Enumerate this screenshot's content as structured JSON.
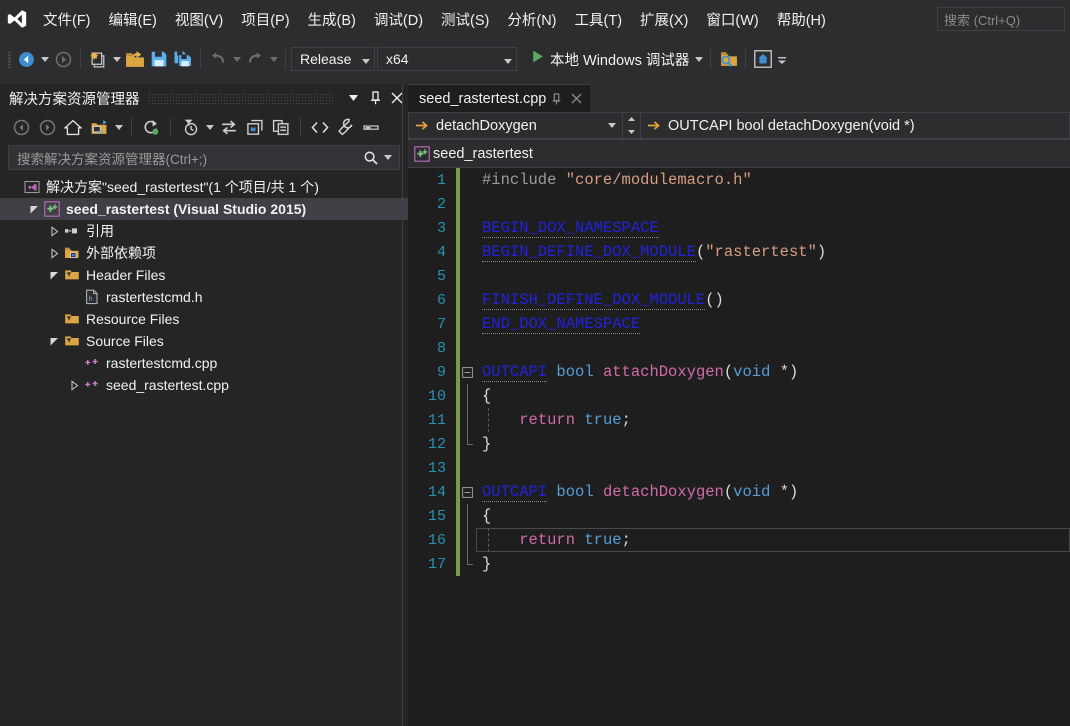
{
  "app": {
    "logo_icon": "visual-studio-logo",
    "theme_bg": "#2d2d30",
    "editor_bg": "#1e1e1e",
    "accent": "#007acc"
  },
  "menubar": {
    "items": [
      {
        "label": "文件(F)",
        "name": "menu-file"
      },
      {
        "label": "编辑(E)",
        "name": "menu-edit"
      },
      {
        "label": "视图(V)",
        "name": "menu-view"
      },
      {
        "label": "项目(P)",
        "name": "menu-project"
      },
      {
        "label": "生成(B)",
        "name": "menu-build"
      },
      {
        "label": "调试(D)",
        "name": "menu-debug"
      },
      {
        "label": "测试(S)",
        "name": "menu-test"
      },
      {
        "label": "分析(N)",
        "name": "menu-analyze"
      },
      {
        "label": "工具(T)",
        "name": "menu-tools"
      },
      {
        "label": "扩展(X)",
        "name": "menu-extensions"
      },
      {
        "label": "窗口(W)",
        "name": "menu-window"
      },
      {
        "label": "帮助(H)",
        "name": "menu-help"
      }
    ],
    "search_placeholder": "搜索 (Ctrl+Q)"
  },
  "toolbar": {
    "nav_back_icon": "navigate-back-icon",
    "nav_forward_icon": "navigate-forward-icon",
    "new_project_icon": "new-project-icon",
    "open_file_icon": "open-file-icon",
    "save_icon": "save-icon",
    "save_all_icon": "save-all-icon",
    "undo_icon": "undo-icon",
    "redo_icon": "redo-icon",
    "config_value": "Release",
    "platform_value": "x64",
    "run_label": "本地 Windows 调试器",
    "run_icon": "play-icon",
    "extra1_icon": "find-in-files-icon",
    "extra2_icon": "live-share-icon",
    "overflow_icon": "toolbar-overflow-icon"
  },
  "solution_explorer": {
    "title": "解决方案资源管理器",
    "header_buttons": [
      {
        "name": "window-dropdown-button",
        "icon": "chevron-down-icon"
      },
      {
        "name": "pin-button",
        "icon": "pin-icon"
      },
      {
        "name": "close-button",
        "icon": "close-icon"
      }
    ],
    "toolbar_icons": [
      "back-icon",
      "forward-icon",
      "home-icon",
      "switch-views-icon",
      "switch-views-dropdown-icon",
      "refresh-icon",
      "pending-changes-filter-icon",
      "pending-changes-dropdown-icon",
      "sync-with-active-document-icon",
      "show-all-files-icon",
      "collapse-all-icon",
      "view-code-icon",
      "properties-icon",
      "preview-icon"
    ],
    "search_placeholder": "搜索解决方案资源管理器(Ctrl+;)",
    "search_icon": "search-icon",
    "search_dropdown_icon": "chevron-down-icon",
    "tree": [
      {
        "label": "解决方案\"seed_rastertest\"(1 个项目/共 1 个)",
        "indent": 0,
        "twist": "none",
        "icon": "solution-icon",
        "selected": false,
        "bold": false,
        "name": "tree-item-solution"
      },
      {
        "label": "seed_rastertest (Visual Studio 2015)",
        "indent": 1,
        "twist": "expanded",
        "icon": "cpp-project-icon",
        "selected": true,
        "bold": true,
        "name": "tree-item-project"
      },
      {
        "label": "引用",
        "indent": 2,
        "twist": "collapsed",
        "icon": "references-icon",
        "selected": false,
        "bold": false,
        "name": "tree-item-references"
      },
      {
        "label": "外部依赖项",
        "indent": 2,
        "twist": "collapsed",
        "icon": "external-dependencies-icon",
        "selected": false,
        "bold": false,
        "name": "tree-item-external-dependencies"
      },
      {
        "label": "Header Files",
        "indent": 2,
        "twist": "expanded",
        "icon": "filter-folder-icon",
        "selected": false,
        "bold": false,
        "name": "tree-item-header-files"
      },
      {
        "label": "rastertestcmd.h",
        "indent": 3,
        "twist": "none",
        "icon": "h-file-icon",
        "selected": false,
        "bold": false,
        "name": "tree-item-rastertestcmd-h"
      },
      {
        "label": "Resource Files",
        "indent": 2,
        "twist": "none",
        "icon": "filter-folder-icon",
        "selected": false,
        "bold": false,
        "name": "tree-item-resource-files"
      },
      {
        "label": "Source Files",
        "indent": 2,
        "twist": "expanded",
        "icon": "filter-folder-icon",
        "selected": false,
        "bold": false,
        "name": "tree-item-source-files"
      },
      {
        "label": "rastertestcmd.cpp",
        "indent": 3,
        "twist": "none",
        "icon": "cpp-file-icon",
        "selected": false,
        "bold": false,
        "name": "tree-item-rastertestcmd-cpp"
      },
      {
        "label": "seed_rastertest.cpp",
        "indent": 3,
        "twist": "collapsed",
        "icon": "cpp-file-icon",
        "selected": false,
        "bold": false,
        "name": "tree-item-seed-rastertest-cpp"
      }
    ]
  },
  "editor": {
    "tab_label": "seed_rastertest.cpp",
    "tab_pin_icon": "pin-icon",
    "tab_close_icon": "close-icon",
    "nav_member": "detachDoxygen",
    "nav_member_icon": "method-icon",
    "nav_signature": "OUTCAPI bool detachDoxygen(void *)",
    "nav_signature_icon": "method-icon",
    "breadcrumb_project": "seed_rastertest",
    "breadcrumb_icon": "cpp-project-icon",
    "current_line": 16,
    "lines": [
      {
        "n": 1,
        "changed": true,
        "fold": "none",
        "guides": [],
        "tokens": [
          {
            "t": "#include ",
            "c": "pp"
          },
          {
            "t": "\"core/modulemacro.h\"",
            "c": "str"
          }
        ]
      },
      {
        "n": 2,
        "changed": true,
        "fold": "none",
        "guides": [],
        "tokens": []
      },
      {
        "n": 3,
        "changed": true,
        "fold": "none",
        "guides": [],
        "tokens": [
          {
            "t": "BEGIN_DOX_NAMESPACE",
            "c": "mac"
          }
        ]
      },
      {
        "n": 4,
        "changed": true,
        "fold": "none",
        "guides": [],
        "tokens": [
          {
            "t": "BEGIN_DEFINE_DOX_MODULE",
            "c": "mac"
          },
          {
            "t": "(",
            "c": "plain"
          },
          {
            "t": "\"rastertest\"",
            "c": "str"
          },
          {
            "t": ")",
            "c": "plain"
          }
        ]
      },
      {
        "n": 5,
        "changed": true,
        "fold": "none",
        "guides": [],
        "tokens": []
      },
      {
        "n": 6,
        "changed": true,
        "fold": "none",
        "guides": [],
        "tokens": [
          {
            "t": "FINISH_DEFINE_DOX_MODULE",
            "c": "mac"
          },
          {
            "t": "()",
            "c": "plain"
          }
        ]
      },
      {
        "n": 7,
        "changed": true,
        "fold": "none",
        "guides": [],
        "tokens": [
          {
            "t": "END_DOX_NAMESPACE",
            "c": "mac"
          }
        ]
      },
      {
        "n": 8,
        "changed": true,
        "fold": "none",
        "guides": [],
        "tokens": []
      },
      {
        "n": 9,
        "changed": true,
        "fold": "minus",
        "guides": [],
        "tokens": [
          {
            "t": "OUTCAPI",
            "c": "mac"
          },
          {
            "t": " bool ",
            "c": "key"
          },
          {
            "t": "attachDoxygen",
            "c": "fn"
          },
          {
            "t": "(",
            "c": "plain"
          },
          {
            "t": "void",
            "c": "key"
          },
          {
            "t": " *)",
            "c": "plain"
          }
        ]
      },
      {
        "n": 10,
        "changed": true,
        "fold": "bar",
        "guides": [],
        "tokens": [
          {
            "t": "{",
            "c": "plain"
          }
        ]
      },
      {
        "n": 11,
        "changed": true,
        "fold": "bar",
        "guides": [
          12
        ],
        "tokens": [
          {
            "t": "    ",
            "c": "plain"
          },
          {
            "t": "return",
            "c": "fn"
          },
          {
            "t": " ",
            "c": "plain"
          },
          {
            "t": "true",
            "c": "key"
          },
          {
            "t": ";",
            "c": "plain"
          }
        ]
      },
      {
        "n": 12,
        "changed": true,
        "fold": "end",
        "guides": [],
        "tokens": [
          {
            "t": "}",
            "c": "plain"
          }
        ]
      },
      {
        "n": 13,
        "changed": true,
        "fold": "none",
        "guides": [],
        "tokens": []
      },
      {
        "n": 14,
        "changed": true,
        "fold": "minus",
        "guides": [],
        "tokens": [
          {
            "t": "OUTCAPI",
            "c": "mac"
          },
          {
            "t": " bool ",
            "c": "key"
          },
          {
            "t": "detachDoxygen",
            "c": "fn"
          },
          {
            "t": "(",
            "c": "plain"
          },
          {
            "t": "void",
            "c": "key"
          },
          {
            "t": " *)",
            "c": "plain"
          }
        ]
      },
      {
        "n": 15,
        "changed": true,
        "fold": "bar",
        "guides": [],
        "tokens": [
          {
            "t": "{",
            "c": "plain"
          }
        ]
      },
      {
        "n": 16,
        "changed": true,
        "fold": "bar",
        "guides": [
          12
        ],
        "tokens": [
          {
            "t": "    ",
            "c": "plain"
          },
          {
            "t": "return",
            "c": "fn"
          },
          {
            "t": " ",
            "c": "plain"
          },
          {
            "t": "true",
            "c": "key"
          },
          {
            "t": ";",
            "c": "plain"
          }
        ]
      },
      {
        "n": 17,
        "changed": true,
        "fold": "end",
        "guides": [],
        "tokens": [
          {
            "t": "}",
            "c": "plain"
          }
        ]
      }
    ]
  }
}
